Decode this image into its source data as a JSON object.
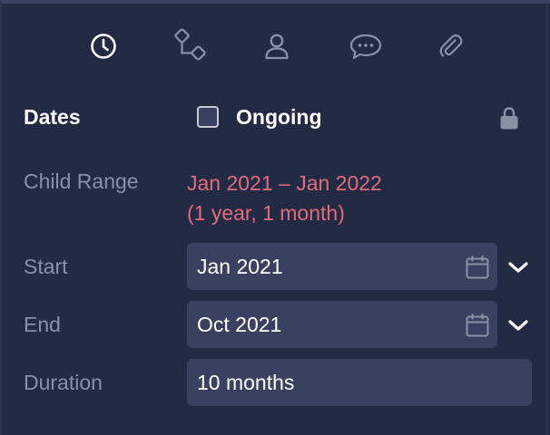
{
  "tabs": [
    {
      "name": "clock-icon",
      "active": true
    },
    {
      "name": "dependencies-icon",
      "active": false
    },
    {
      "name": "person-icon",
      "active": false
    },
    {
      "name": "comment-icon",
      "active": false
    },
    {
      "name": "paperclip-icon",
      "active": false
    }
  ],
  "dates": {
    "title": "Dates",
    "ongoing_label": "Ongoing",
    "ongoing_checked": false,
    "lock_icon": "lock-icon"
  },
  "child_range": {
    "label": "Child Range",
    "range": "Jan 2021 – Jan 2022",
    "duration": "(1 year, 1 month)"
  },
  "start": {
    "label": "Start",
    "value": "Jan 2021"
  },
  "end": {
    "label": "End",
    "value": "Oct 2021"
  },
  "duration": {
    "label": "Duration",
    "value": "10 months"
  },
  "colors": {
    "background": "#232a44",
    "field": "#3a4160",
    "accent_red": "#e06c7c",
    "muted_text": "#8a90a6",
    "icon": "#8a90a6",
    "active_icon": "#ffffff"
  }
}
